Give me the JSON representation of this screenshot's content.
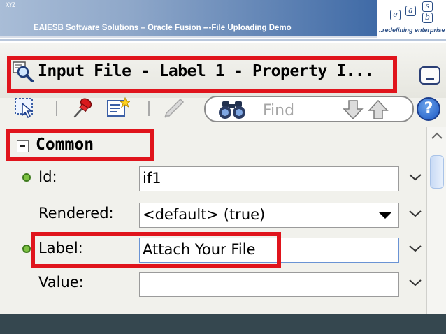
{
  "slide": {
    "title": "EAIESB  Software Solutions – Oracle Fusion ---File Uploading Demo",
    "logo_letters": [
      "e",
      "a",
      "s",
      "b"
    ],
    "tagline": "..redefining enterprise",
    "deco_mark": "XYZ"
  },
  "inspector": {
    "title": "Input File - Label 1 - Property I...",
    "find_placeholder": "Find",
    "help_label": "?",
    "section": "Common",
    "properties": [
      {
        "label": "Id:",
        "value": "if1",
        "required": true,
        "type": "text"
      },
      {
        "label": "Rendered:",
        "value": "<default> (true)",
        "required": false,
        "type": "select"
      },
      {
        "label": "Label:",
        "value": "Attach Your File",
        "required": true,
        "type": "text"
      },
      {
        "label": "Value:",
        "value": "",
        "required": false,
        "type": "text"
      }
    ]
  },
  "colors": {
    "highlight": "#e0141c",
    "header_band": "#3f6aa6",
    "footer_band": "#35474f",
    "required_bullet": "#7dc242"
  },
  "icons": [
    "search-icon",
    "select-icon",
    "pin-icon",
    "edit-icon",
    "pencil-icon",
    "binoculars-icon",
    "arrow-down-icon",
    "arrow-up-icon",
    "help-icon",
    "chevron-down-icon",
    "minimize-icon"
  ]
}
